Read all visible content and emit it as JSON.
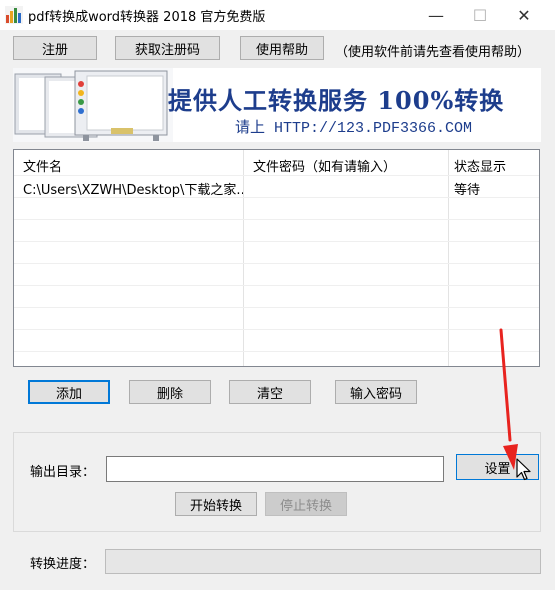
{
  "window": {
    "title": "pdf转换成word转换器 2018 官方免费版",
    "minimize_glyph": "—",
    "maximize_glyph": "☐",
    "close_glyph": "✕"
  },
  "toolbar": {
    "register_label": "注册",
    "get_code_label": "获取注册码",
    "help_label": "使用帮助",
    "hint": "（使用软件前请先查看使用帮助）"
  },
  "banner": {
    "title": "提供人工转换服务 100%转换",
    "subtitle": "请上  HTTP://123.PDF3366.COM"
  },
  "file_table": {
    "headers": [
      "文件名",
      "文件密码（如有请输入）",
      "状态显示"
    ],
    "rows": [
      [
        "C:\\Users\\XZWH\\Desktop\\下载之家....",
        "",
        "等待"
      ]
    ]
  },
  "list_actions": {
    "add_label": "添加",
    "delete_label": "删除",
    "clear_label": "清空",
    "password_label": "输入密码"
  },
  "output": {
    "label": "输出目录：",
    "value": "",
    "settings_label": "设置",
    "start_label": "开始转换",
    "stop_label": "停止转换"
  },
  "progress": {
    "label": "转换进度：",
    "value": 0
  },
  "colors": {
    "accent": "#0078d7",
    "banner_text": "#1d3d8c",
    "annotation_arrow": "#e8231f"
  }
}
